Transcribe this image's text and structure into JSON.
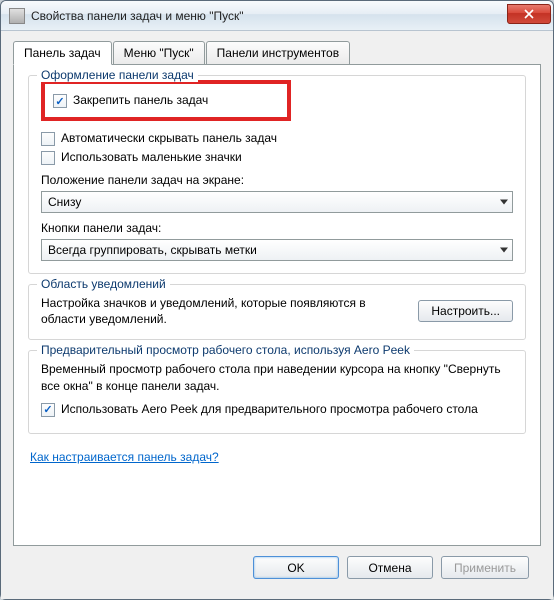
{
  "window": {
    "title": "Свойства панели задач и меню \"Пуск\""
  },
  "tabs": [
    {
      "label": "Панель задач"
    },
    {
      "label": "Меню \"Пуск\""
    },
    {
      "label": "Панели инструментов"
    }
  ],
  "group_taskbar": {
    "title": "Оформление панели задач",
    "lock_label": "Закрепить панель задач",
    "autohide_label": "Автоматически скрывать панель задач",
    "smallicons_label": "Использовать маленькие значки",
    "position_label": "Положение панели задач на экране:",
    "position_value": "Снизу",
    "buttons_label": "Кнопки панели задач:",
    "buttons_value": "Всегда группировать, скрывать метки"
  },
  "group_notif": {
    "title": "Область уведомлений",
    "desc": "Настройка значков и уведомлений, которые появляются в области уведомлений.",
    "button": "Настроить..."
  },
  "group_aero": {
    "title": "Предварительный просмотр рабочего стола, используя Aero Peek",
    "desc": "Временный просмотр рабочего стола при наведении курсора на кнопку \"Свернуть все окна\" в конце панели задач.",
    "check_label": "Использовать Aero Peek для предварительного просмотра рабочего стола"
  },
  "help_link": "Как настраивается панель задач?",
  "footer": {
    "ok": "OK",
    "cancel": "Отмена",
    "apply": "Применить"
  }
}
